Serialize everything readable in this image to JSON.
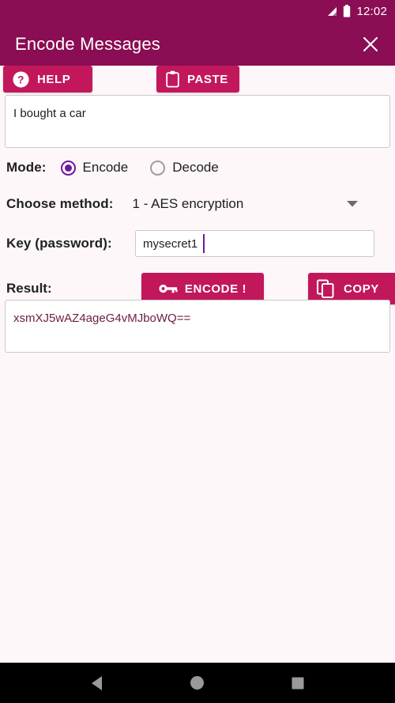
{
  "status_bar": {
    "time": "12:02",
    "signal_icon": "signal-triangle-icon",
    "battery_icon": "battery-full-icon"
  },
  "app_bar": {
    "title": "Encode Messages",
    "close_icon": "close-x-icon",
    "background_color": "#8b0d53"
  },
  "toolbar": {
    "help_label": "HELP",
    "help_icon": "question-mark-circle-icon",
    "paste_label": "PASTE",
    "paste_icon": "clipboard-icon",
    "button_color": "#c2185b"
  },
  "message": {
    "value": "I bought a car",
    "placeholder": ""
  },
  "mode": {
    "label": "Mode:",
    "selected": "Encode",
    "accent_color": "#6a1b9a",
    "options": [
      {
        "label": "Encode",
        "checked": true
      },
      {
        "label": "Decode",
        "checked": false
      }
    ]
  },
  "method": {
    "label": "Choose method:",
    "value": "1 - AES encryption",
    "chevron_icon": "chevron-down-icon"
  },
  "key": {
    "label": "Key (password):",
    "value": "mysecret1",
    "placeholder": ""
  },
  "result": {
    "label": "Result:",
    "encode_label": "ENCODE !",
    "encode_icon": "key-icon",
    "copy_label": "COPY",
    "copy_icon": "copy-duplicate-icon",
    "value": "xsmXJ5wAZ4ageG4vMJboWQ==",
    "text_color": "#6d2045"
  },
  "nav_bar": {
    "back_icon": "back-triangle-icon",
    "home_icon": "home-circle-icon",
    "recents_icon": "recents-square-icon"
  }
}
